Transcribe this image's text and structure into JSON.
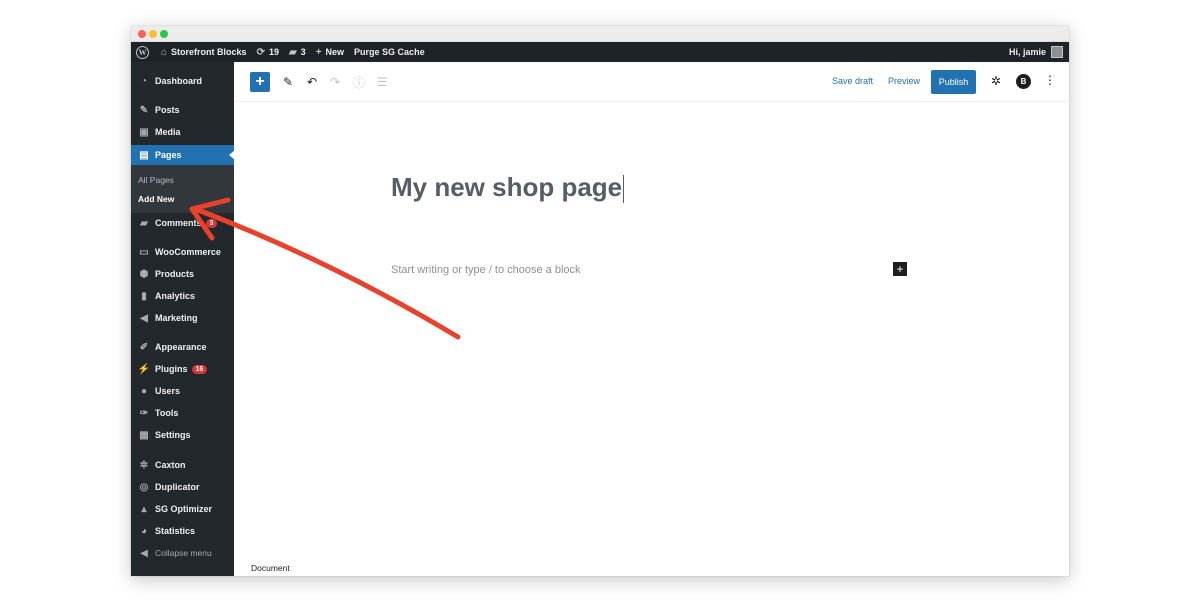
{
  "admin_bar": {
    "site_name": "Storefront Blocks",
    "updates_count": "19",
    "comments_count": "3",
    "new_label": "New",
    "purge_label": "Purge SG Cache",
    "greeting": "Hi, jamie"
  },
  "sidebar": {
    "items": [
      {
        "label": "Dashboard",
        "icon": "dashboard-icon"
      },
      {
        "label": "Posts",
        "icon": "pin-icon"
      },
      {
        "label": "Media",
        "icon": "media-icon"
      },
      {
        "label": "Pages",
        "icon": "pages-icon",
        "active": true
      },
      {
        "label": "Comments",
        "icon": "comments-icon",
        "badge": "3"
      },
      {
        "label": "WooCommerce",
        "icon": "woocommerce-icon"
      },
      {
        "label": "Products",
        "icon": "products-icon"
      },
      {
        "label": "Analytics",
        "icon": "analytics-icon"
      },
      {
        "label": "Marketing",
        "icon": "megaphone-icon"
      },
      {
        "label": "Appearance",
        "icon": "brush-icon"
      },
      {
        "label": "Plugins",
        "icon": "plugin-icon",
        "badge": "16"
      },
      {
        "label": "Users",
        "icon": "users-icon"
      },
      {
        "label": "Tools",
        "icon": "wrench-icon"
      },
      {
        "label": "Settings",
        "icon": "settings-icon"
      },
      {
        "label": "Caxton",
        "icon": "gear-icon"
      },
      {
        "label": "Duplicator",
        "icon": "duplicator-icon"
      },
      {
        "label": "SG Optimizer",
        "icon": "sg-optimizer-icon"
      },
      {
        "label": "Statistics",
        "icon": "pie-icon"
      },
      {
        "label": "Collapse menu",
        "icon": "collapse-icon"
      }
    ],
    "submenu": {
      "all_pages": "All Pages",
      "add_new": "Add New"
    }
  },
  "toolbar": {
    "save_draft": "Save draft",
    "preview": "Preview",
    "publish": "Publish",
    "plugin_badge": "B"
  },
  "editor": {
    "title": "My new shop page",
    "placeholder": "Start writing or type / to choose a block",
    "footer": "Document"
  },
  "colors": {
    "admin_dark": "#23282d",
    "accent_blue": "#2271b1",
    "arrow_red": "#e8412c"
  }
}
